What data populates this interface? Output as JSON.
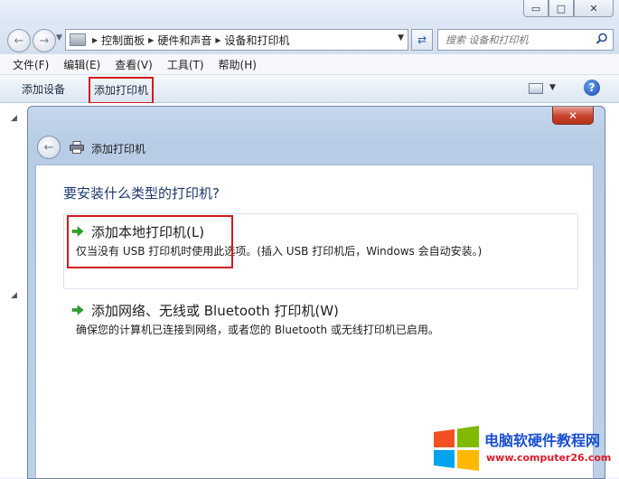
{
  "window": {
    "min_glyph": "▭",
    "max_glyph": "□",
    "close_glyph": "✕"
  },
  "address": {
    "crumbs": [
      "控制面板",
      "硬件和声音",
      "设备和打印机"
    ]
  },
  "search": {
    "placeholder": "搜索 设备和打印机"
  },
  "menu": {
    "items": [
      "文件(F)",
      "编辑(E)",
      "查看(V)",
      "工具(T)",
      "帮助(H)"
    ]
  },
  "commands": {
    "add_device": "添加设备",
    "add_printer": "添加打印机",
    "help_glyph": "?"
  },
  "dialog": {
    "title": "添加打印机",
    "question": "要安装什么类型的打印机?",
    "options": [
      {
        "title": "添加本地打印机(L)",
        "description": "仅当没有 USB 打印机时使用此选项。(插入 USB 打印机后，Windows 会自动安装。)"
      },
      {
        "title": "添加网络、无线或 Bluetooth 打印机(W)",
        "description": "确保您的计算机已连接到网络，或者您的 Bluetooth 或无线打印机已启用。"
      }
    ]
  },
  "watermark": {
    "title": "电脑软硬件教程网",
    "url": "www.computer26.com"
  },
  "colors": {
    "highlight": "#d31b1b",
    "arrow_green": "#2aa52a",
    "question_blue": "#1e3a6e"
  }
}
